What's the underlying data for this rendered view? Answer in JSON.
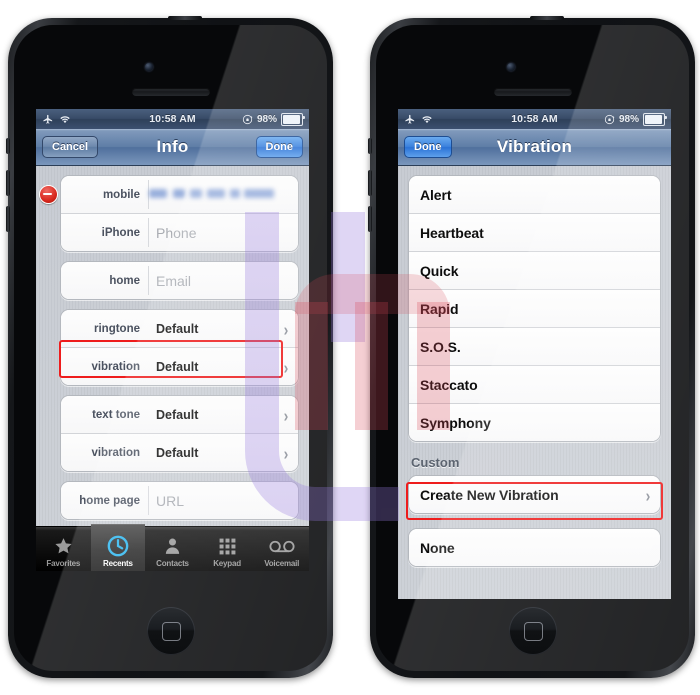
{
  "statusbar": {
    "time": "10:58 AM",
    "battery_pct": "98%",
    "icons": [
      "airplane-mode-icon",
      "wifi-icon",
      "rotation-lock-icon",
      "battery-icon"
    ]
  },
  "left_phone": {
    "navbar": {
      "cancel_label": "Cancel",
      "title": "Info",
      "done_label": "Done"
    },
    "groups": [
      {
        "rows": [
          {
            "label": "mobile",
            "value": "",
            "redacted": true,
            "type": "field",
            "delete_badge": true
          },
          {
            "label": "iPhone",
            "value": "Phone",
            "placeholder": true,
            "type": "field"
          }
        ]
      },
      {
        "rows": [
          {
            "label": "home",
            "value": "Email",
            "placeholder": true,
            "type": "field"
          }
        ]
      },
      {
        "rows": [
          {
            "label": "ringtone",
            "value": "Default",
            "type": "disclosure"
          },
          {
            "label": "vibration",
            "value": "Default",
            "type": "disclosure",
            "highlighted": true
          }
        ]
      },
      {
        "rows": [
          {
            "label": "text tone",
            "value": "Default",
            "type": "disclosure"
          },
          {
            "label": "vibration",
            "value": "Default",
            "type": "disclosure"
          }
        ]
      },
      {
        "rows": [
          {
            "label": "home page",
            "value": "URL",
            "placeholder": true,
            "type": "field"
          }
        ]
      }
    ],
    "tabbar": [
      {
        "label": "Favorites",
        "icon": "star-icon",
        "selected": false
      },
      {
        "label": "Recents",
        "icon": "clock-icon",
        "selected": true
      },
      {
        "label": "Contacts",
        "icon": "person-icon",
        "selected": false
      },
      {
        "label": "Keypad",
        "icon": "keypad-grid-icon",
        "selected": false
      },
      {
        "label": "Voicemail",
        "icon": "voicemail-tape-icon",
        "selected": false
      }
    ]
  },
  "right_phone": {
    "navbar": {
      "done_label": "Done",
      "title": "Vibration"
    },
    "standard_items": [
      {
        "label": "Alert"
      },
      {
        "label": "Heartbeat"
      },
      {
        "label": "Quick"
      },
      {
        "label": "Rapid"
      },
      {
        "label": "S.O.S."
      },
      {
        "label": "Staccato"
      },
      {
        "label": "Symphony"
      }
    ],
    "custom_header": "Custom",
    "custom_items": [
      {
        "label": "Create New Vibration",
        "disclosure": true,
        "highlighted": true
      }
    ],
    "none_items": [
      {
        "label": "None"
      }
    ]
  },
  "colors": {
    "highlight_red": "#ee1c1c",
    "nav_blue": "#3c82dd",
    "screen_bg": "#cdd1d7"
  },
  "watermark": {
    "text": "JM"
  }
}
